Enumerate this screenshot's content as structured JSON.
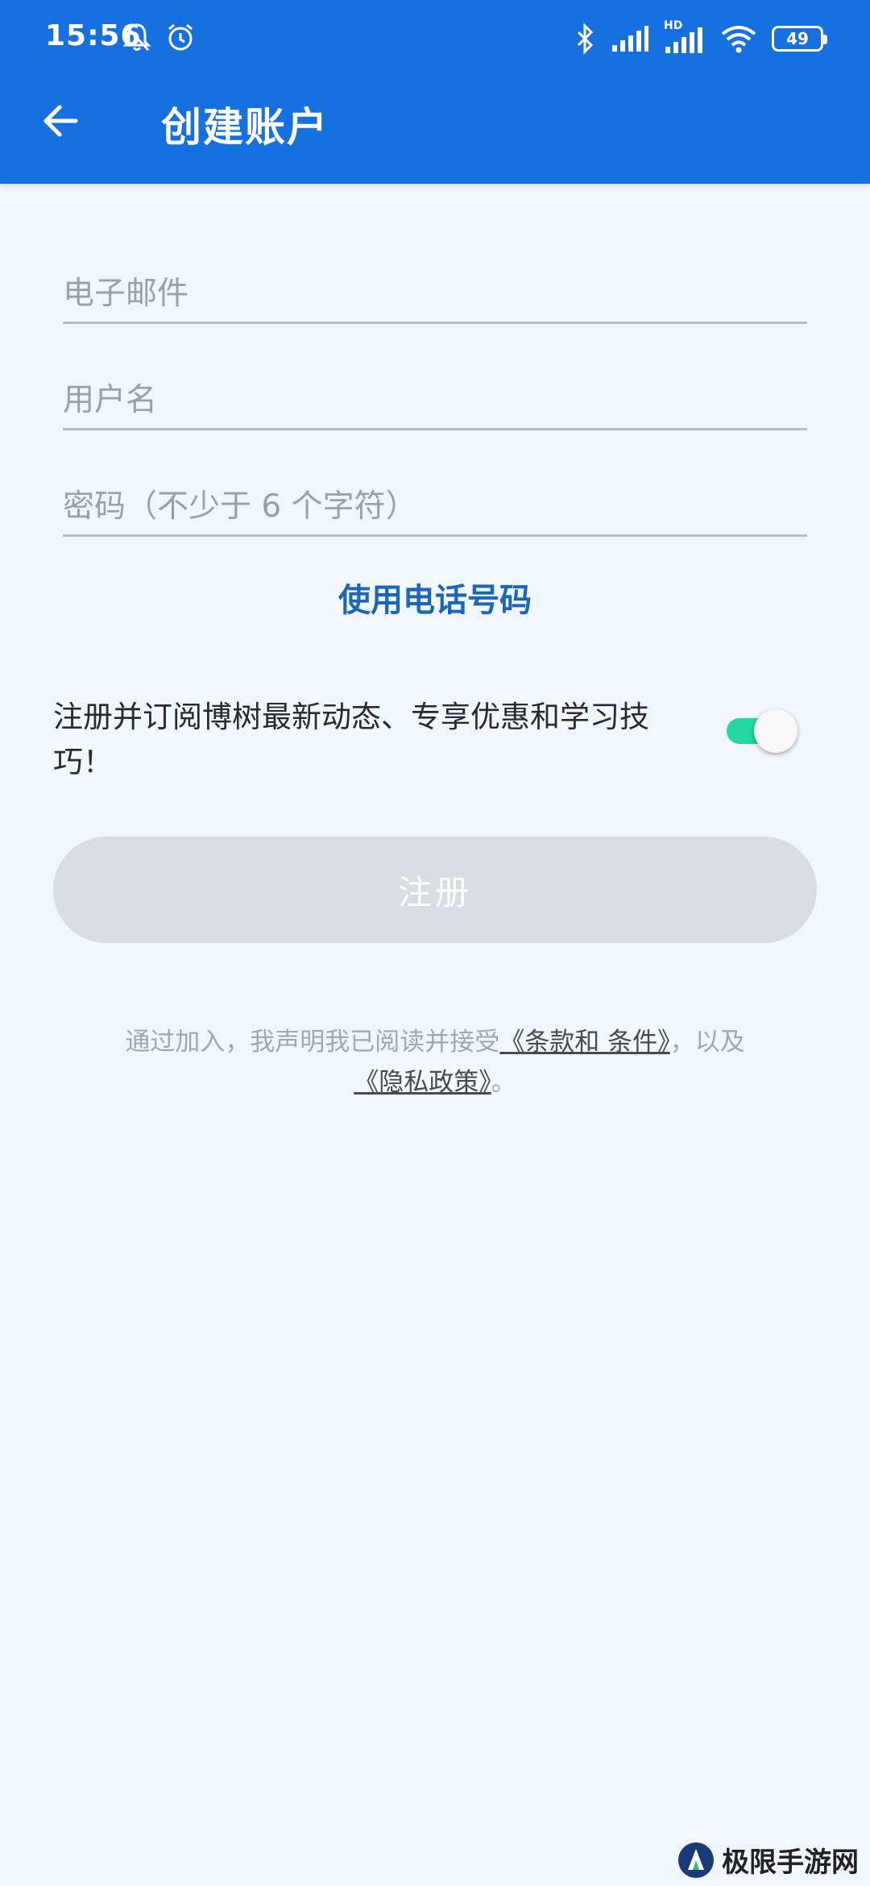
{
  "status_bar": {
    "time": "15:56",
    "battery": "49",
    "network_label": "HD",
    "icons": [
      "mute-bell-icon",
      "alarm-icon",
      "bluetooth-icon",
      "signal-icon",
      "hd-signal-icon",
      "wifi-icon",
      "battery-icon"
    ]
  },
  "header": {
    "back_icon": "arrow-left-icon",
    "title": "创建账户"
  },
  "form": {
    "email_placeholder": "电子邮件",
    "email_value": "",
    "username_placeholder": "用户名",
    "username_value": "",
    "password_placeholder": "密码（不少于 6 个字符）",
    "password_value": "",
    "phone_link": "使用电话号码"
  },
  "subscribe": {
    "text": "注册并订阅博树最新动态、专享优惠和学习技巧！",
    "enabled": true
  },
  "register_button": "注册",
  "terms": {
    "prefix": "通过加入，我声明我已阅读并接受",
    "terms_link": "《条款和 条件》",
    "middle": "，以及",
    "privacy_link": "《隐私政策》",
    "suffix": "。"
  },
  "watermark": {
    "text": "极限手游网"
  },
  "colors": {
    "primary": "#1770e0",
    "background": "#f2f7fe",
    "toggle_on": "#22d8a0",
    "link": "#1a66b7",
    "button_disabled": "#d9dde3"
  }
}
